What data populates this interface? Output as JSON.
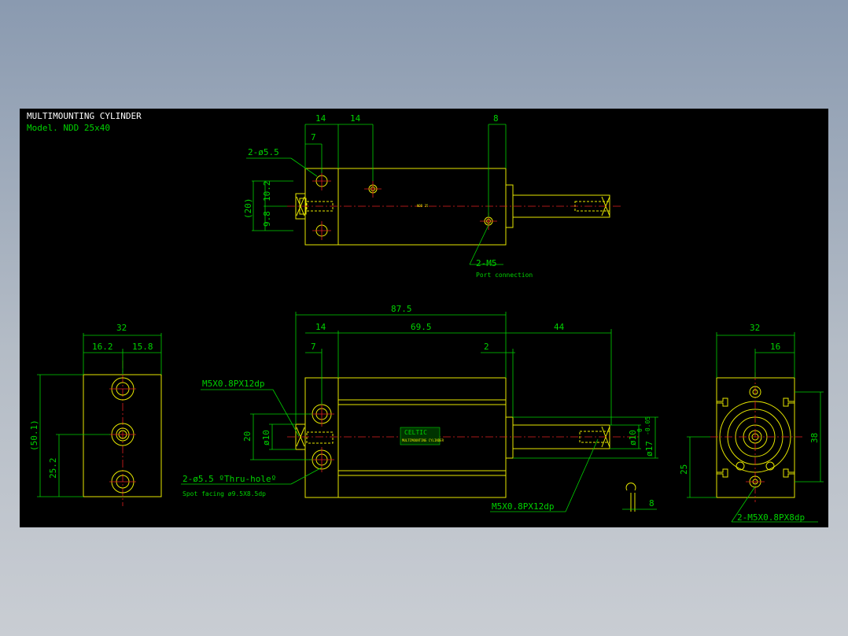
{
  "title": {
    "main": "MULTIMOUNTING CYLINDER",
    "model": "Model. NDD 25x40"
  },
  "top_view": {
    "dims": {
      "d14a": "14",
      "d14b": "14",
      "d7": "7",
      "d8": "8",
      "d20": "(20)",
      "d10_2": "10.2",
      "d9_8": "9.8"
    },
    "hole_note": "2-ø5.5",
    "port_note": "2-M5",
    "port_sub": "Port connection",
    "rod_tag": "NDD 25"
  },
  "left_view": {
    "dims": {
      "d32": "32",
      "d16_2": "16.2",
      "d15_8": "15.8",
      "d50_1": "(50.1)",
      "d25_2": "25.2"
    }
  },
  "front_view": {
    "dims": {
      "d87_5": "87.5",
      "d14": "14",
      "d69_5": "69.5",
      "d44": "44",
      "d7": "7",
      "d2": "2",
      "d20": "20",
      "dphi10": "ø10",
      "dphi10r": "ø10",
      "dphi17": "ø17",
      "dtol": "-0.05",
      "dtol0": "0",
      "d8": "8"
    },
    "thread_left": "M5X0.8PX12dp",
    "thread_right": "M5X0.8PX12dp",
    "hole_note": "2-ø5.5 ºThru-holeº",
    "spot_note": "Spot facing ø9.5X8.5dp",
    "body_label": "CELTIC",
    "body_sub": "MULTIMOUNTING CYLINDER"
  },
  "right_view": {
    "dims": {
      "d32": "32",
      "d16": "16",
      "d38": "38",
      "d25": "25"
    },
    "thread_note": "2-M5X0.8PX8dp"
  },
  "colors": {
    "outline": "#e6e600",
    "dimension": "#00d200",
    "centerline": "#e02020",
    "text": "#ffffff",
    "background": "#000000"
  }
}
